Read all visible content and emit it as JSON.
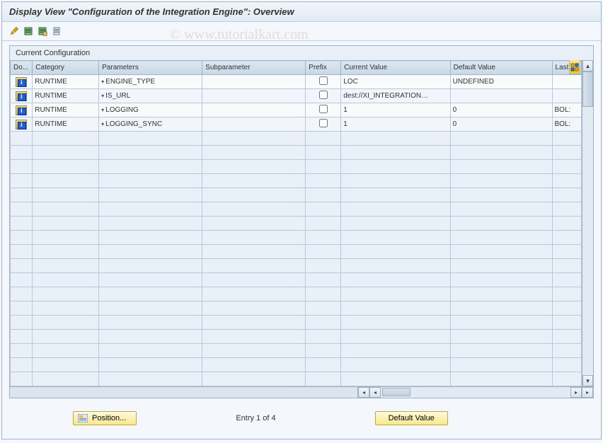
{
  "title": "Display View \"Configuration of the Integration Engine\": Overview",
  "panel_title": "Current Configuration",
  "watermark": "© www.tutorialkart.com",
  "columns": {
    "c0": "Do...",
    "c1": "Category",
    "c2": "Parameters",
    "c3": "Subparameter",
    "c4": "Prefix",
    "c5": "Current Value",
    "c6": "Default Value",
    "c7": "Last"
  },
  "rows": [
    {
      "category": "RUNTIME",
      "parameters": "ENGINE_TYPE",
      "subparameter": "",
      "prefix": false,
      "current_value": "LOC",
      "default_value": "UNDEFINED",
      "last": ""
    },
    {
      "category": "RUNTIME",
      "parameters": "IS_URL",
      "subparameter": "",
      "prefix": false,
      "current_value": "dest://XI_INTEGRATION…",
      "default_value": "",
      "last": ""
    },
    {
      "category": "RUNTIME",
      "parameters": "LOGGING",
      "subparameter": "",
      "prefix": false,
      "current_value": "1",
      "default_value": "0",
      "last": "BOL:"
    },
    {
      "category": "RUNTIME",
      "parameters": "LOGGING_SYNC",
      "subparameter": "",
      "prefix": false,
      "current_value": "1",
      "default_value": "0",
      "last": "BOL:"
    }
  ],
  "footer": {
    "position_label": "Position...",
    "entry_text": "Entry 1 of 4",
    "default_label": "Default Value"
  }
}
